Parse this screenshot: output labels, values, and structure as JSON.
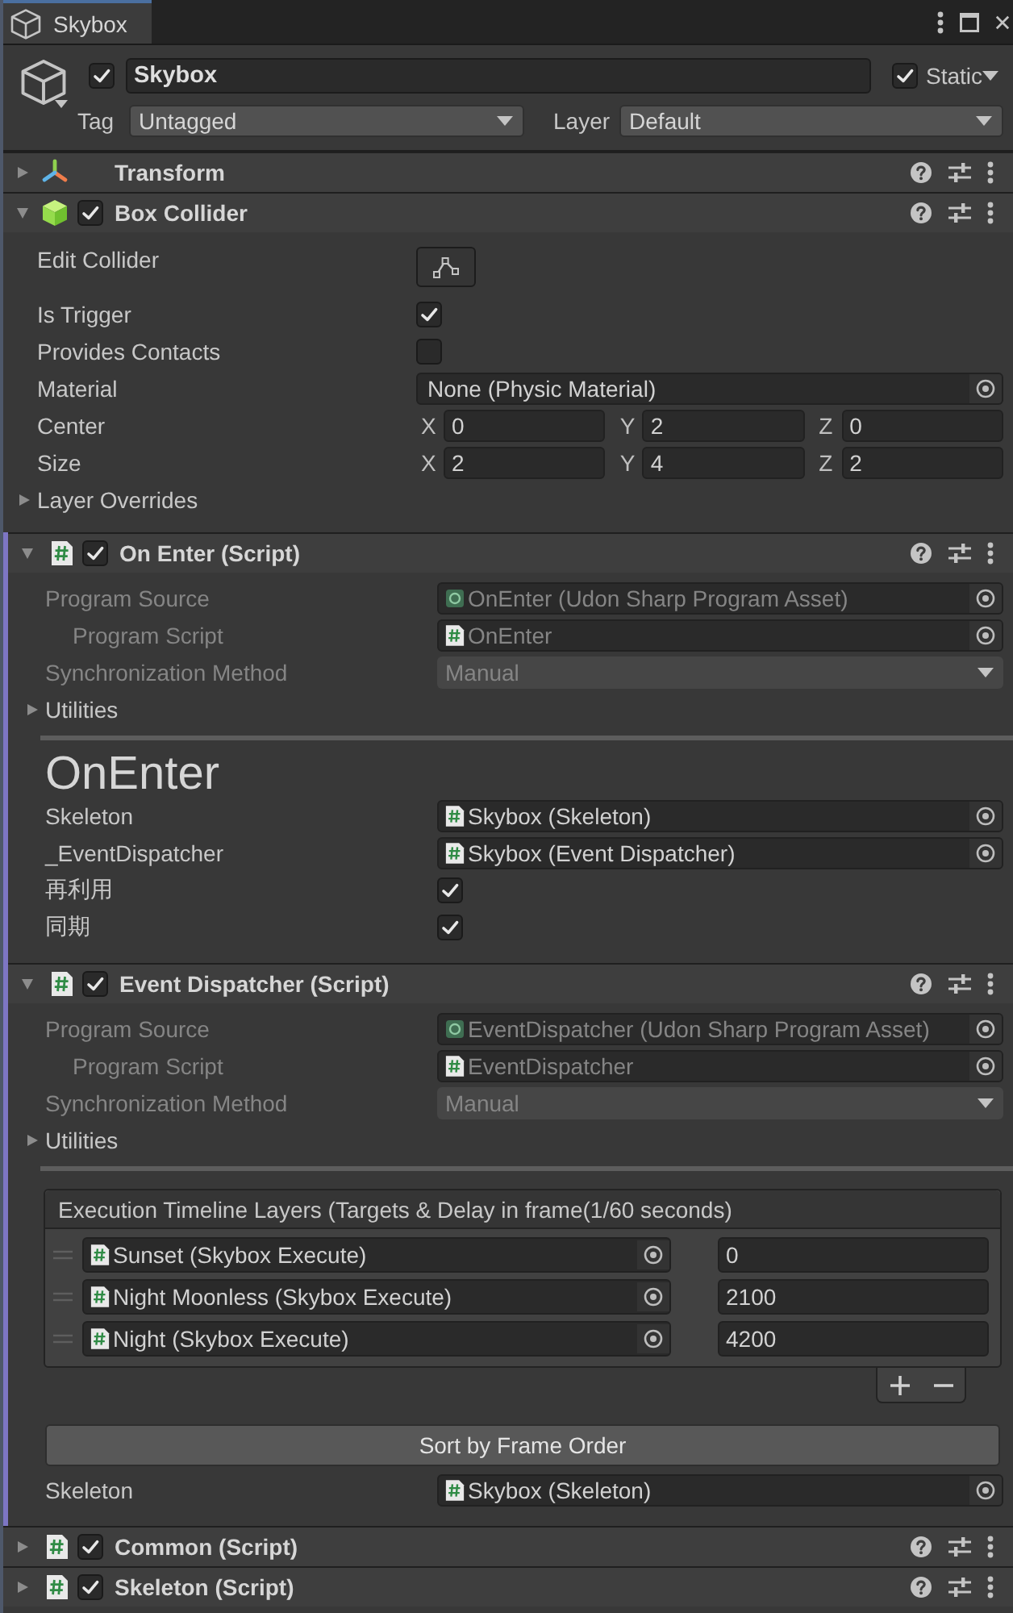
{
  "window": {
    "tab": {
      "label": "Skybox",
      "selected": true
    }
  },
  "object": {
    "active": true,
    "name": "Skybox",
    "static": true,
    "static_label": "Static",
    "tag_label": "Tag",
    "tag": "Untagged",
    "layer_label": "Layer",
    "layer": "Default"
  },
  "components": [
    {
      "kind": "transform",
      "title": "Transform",
      "expanded": false
    },
    {
      "kind": "collider",
      "title": "Box Collider",
      "enabled": true,
      "expanded": true,
      "fields": [
        {
          "kind": "edit",
          "label": "Edit Collider"
        },
        {
          "kind": "checkbox",
          "label": "Is Trigger",
          "checked": true
        },
        {
          "kind": "checkbox",
          "label": "Provides Contacts",
          "checked": false
        },
        {
          "kind": "object",
          "label": "Material",
          "value": "None (Physic Material)"
        },
        {
          "kind": "vector3",
          "label": "Center",
          "axes": [
            {
              "axis": "X",
              "value": "0"
            },
            {
              "axis": "Y",
              "value": "2"
            },
            {
              "axis": "Z",
              "value": "0"
            }
          ]
        },
        {
          "kind": "vector3",
          "label": "Size",
          "axes": [
            {
              "axis": "X",
              "value": "2"
            },
            {
              "axis": "Y",
              "value": "4"
            },
            {
              "axis": "Z",
              "value": "2"
            }
          ]
        },
        {
          "kind": "foldout",
          "label": "Layer Overrides",
          "expanded": false
        }
      ]
    },
    {
      "kind": "script",
      "title": "On Enter (Script)",
      "enabled": true,
      "expanded": true,
      "program": {
        "disabled": true,
        "source": {
          "label": "Program Source",
          "value": "OnEnter (Udon Sharp Program Asset)",
          "children": [
            {
              "label": "Program Script",
              "value": "OnEnter"
            }
          ]
        },
        "sync": {
          "label": "Synchronization Method",
          "value": "Manual"
        }
      },
      "utilities": {
        "label": "Utilities",
        "expanded": false
      },
      "heading": "OnEnter",
      "fields": [
        {
          "kind": "script_ref",
          "label": "Skeleton",
          "value": "Skybox (Skeleton)"
        },
        {
          "kind": "script_ref",
          "label": "_EventDispatcher",
          "value": "Skybox (Event Dispatcher)"
        },
        {
          "kind": "checkbox",
          "label": "再利用",
          "checked": true
        },
        {
          "kind": "checkbox",
          "label": "同期",
          "checked": true
        }
      ]
    },
    {
      "kind": "script",
      "title": "Event Dispatcher (Script)",
      "enabled": true,
      "expanded": true,
      "program": {
        "disabled": true,
        "source": {
          "label": "Program Source",
          "value": "EventDispatcher (Udon Sharp Program Asset)",
          "children": [
            {
              "label": "Program Script",
              "value": "EventDispatcher"
            }
          ]
        },
        "sync": {
          "label": "Synchronization Method",
          "value": "Manual"
        }
      },
      "utilities": {
        "label": "Utilities",
        "expanded": false
      },
      "fields": [
        {
          "kind": "list",
          "header": "Execution Timeline Layers (Targets & Delay in frame(1/60 seconds)",
          "items": [
            {
              "target": "Sunset (Skybox Execute)",
              "delay": "0"
            },
            {
              "target": "Night Moonless (Skybox Execute)",
              "delay": "2100"
            },
            {
              "target": "Night (Skybox Execute)",
              "delay": "4200"
            }
          ]
        },
        {
          "kind": "button",
          "label": "Sort by Frame Order"
        },
        {
          "kind": "script_ref",
          "label": "Skeleton",
          "value": "Skybox (Skeleton)"
        }
      ]
    },
    {
      "kind": "script",
      "title": "Common (Script)",
      "enabled": true,
      "expanded": false
    },
    {
      "kind": "script",
      "title": "Skeleton (Script)",
      "enabled": true,
      "expanded": false
    }
  ]
}
